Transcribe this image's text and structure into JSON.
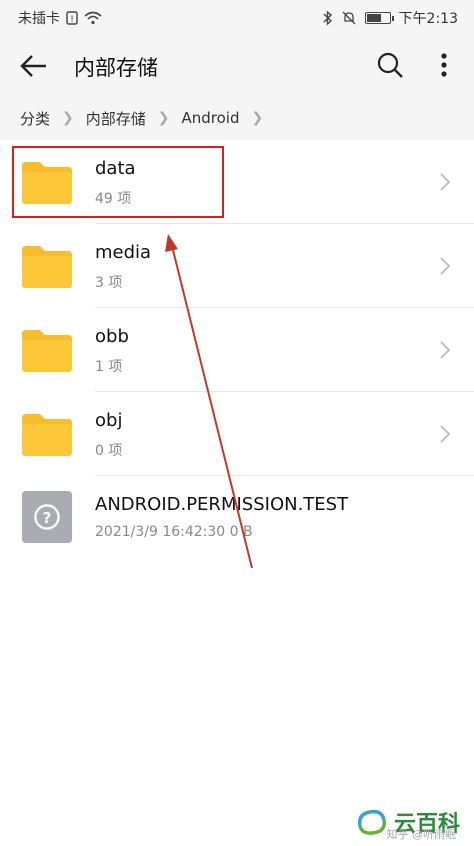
{
  "status_bar": {
    "carrier": "未插卡",
    "time": "下午2:13"
  },
  "app_bar": {
    "title": "内部存储"
  },
  "breadcrumbs": [
    {
      "label": "分类"
    },
    {
      "label": "内部存储"
    },
    {
      "label": "Android"
    }
  ],
  "files": [
    {
      "name": "data",
      "meta": "49 项",
      "type": "folder",
      "icon": "folder-icon"
    },
    {
      "name": "media",
      "meta": "3 项",
      "type": "folder",
      "icon": "folder-icon"
    },
    {
      "name": "obb",
      "meta": "1 项",
      "type": "folder",
      "icon": "folder-icon"
    },
    {
      "name": "obj",
      "meta": "0 项",
      "type": "folder",
      "icon": "folder-icon"
    },
    {
      "name": "ANDROID.PERMISSION.TEST",
      "meta": "2021/3/9 16:42:30 0 B",
      "type": "file",
      "icon": "unknown-file-icon"
    }
  ],
  "watermark": {
    "brand": "云百科",
    "sub": "知乎 @听雨眠"
  },
  "colors": {
    "folder": "#F9BD2B",
    "highlight": "#D62020",
    "arrow": "#C0392B",
    "bar_bg": "#F5F5F5"
  }
}
